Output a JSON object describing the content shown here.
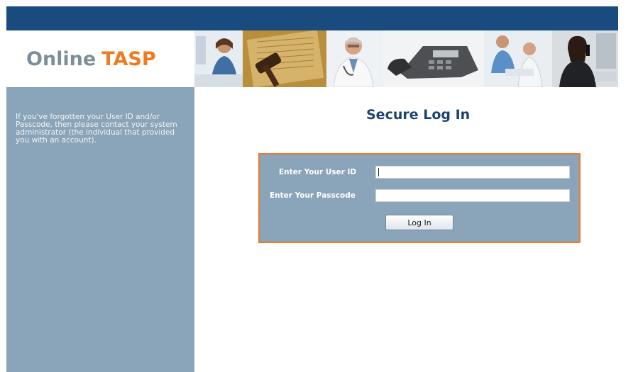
{
  "header": {
    "logo_word1": "Online",
    "logo_word2": "TASP"
  },
  "banner": {
    "images": [
      "woman-at-desk",
      "gavel-and-documents",
      "doctor",
      "telephone",
      "medical-staff",
      "businesswoman-on-phone"
    ]
  },
  "sidebar": {
    "help_text": "If you've forgotten your User ID and/or Passcode, then please contact your system administrator (the individual that provided you with an account)."
  },
  "main": {
    "title": "Secure Log In",
    "user_id_label": "Enter Your User ID",
    "user_id_value": "",
    "passcode_label": "Enter Your Passcode",
    "passcode_value": "",
    "login_button": "Log In"
  },
  "colors": {
    "top_bar": "#1a4b7e",
    "sidebar": "#8aa4b9",
    "accent_orange": "#ef7b22",
    "title": "#1d4270"
  }
}
